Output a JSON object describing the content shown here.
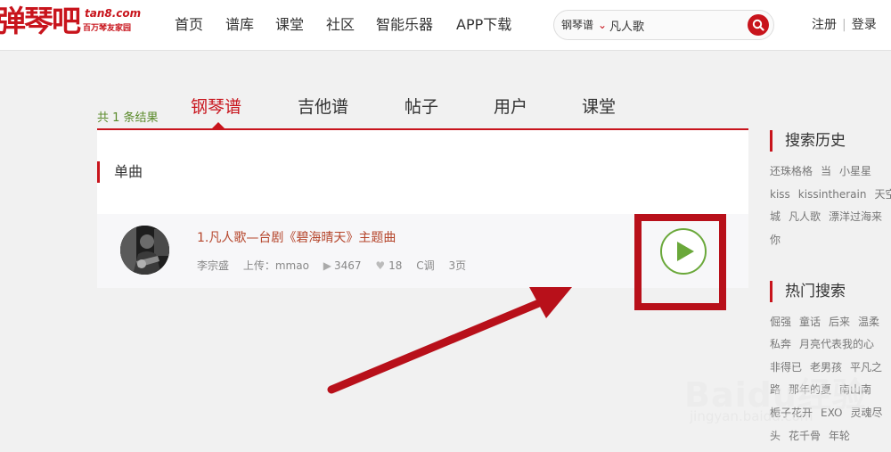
{
  "header": {
    "logo": {
      "main": "弹琴吧",
      "domain": "tan8.com",
      "tagline": "百万琴友家园"
    },
    "nav": [
      "首页",
      "谱库",
      "课堂",
      "社区",
      "智能乐器",
      "APP下载"
    ],
    "search": {
      "scope": "钢琴谱",
      "value": "凡人歌"
    },
    "auth": {
      "register": "注册",
      "login": "登录"
    }
  },
  "results": {
    "count_text": "共 1 条结果",
    "tabs": [
      "钢琴谱",
      "吉他谱",
      "帖子",
      "用户",
      "课堂"
    ],
    "active_tab": 0,
    "section": "单曲",
    "items": [
      {
        "title": "1.凡人歌—台剧《碧海晴天》主题曲",
        "artist": "李宗盛",
        "uploader": "上传：mmao",
        "plays": "3467",
        "likes": "18",
        "key": "C调",
        "pages": "3页"
      }
    ]
  },
  "sidebar": {
    "history_title": "搜索历史",
    "history_lines": [
      [
        "还珠格格",
        "当",
        "小星星"
      ],
      [
        "kiss",
        "kissintherain",
        "天空"
      ],
      [
        "城",
        "凡人歌",
        "漂洋过海来"
      ],
      [
        "你"
      ]
    ],
    "hot_title": "热门搜索",
    "hot_lines": [
      [
        "倔强",
        "童话",
        "后来",
        "温柔"
      ],
      [
        "私奔",
        "月亮代表我的心"
      ],
      [
        "非得已",
        "老男孩",
        "平凡之"
      ],
      [
        "路",
        "那年的夏",
        "南山南"
      ],
      [
        "栀子花开",
        "EXO",
        "灵魂尽"
      ],
      [
        "头",
        "花千骨",
        "年轮"
      ]
    ]
  },
  "watermark": {
    "text": "Baidu经验",
    "url": "jingyan.baidu.com"
  },
  "colors": {
    "brand": "#c8141c",
    "count": "#5a8a2a",
    "play": "#6aa83a",
    "title": "#b5452b",
    "annotation": "#b8101a"
  }
}
